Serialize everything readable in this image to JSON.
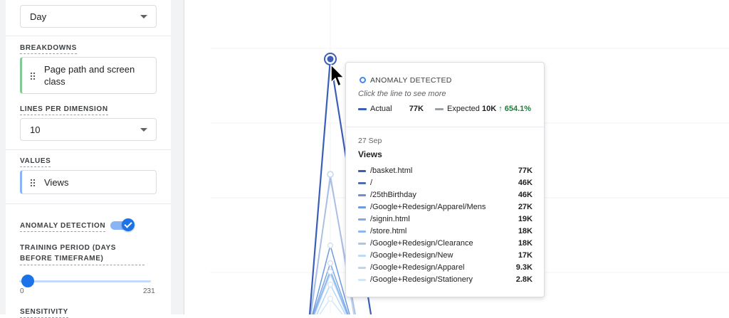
{
  "settings": {
    "granularity": {
      "value": "Day"
    },
    "breakdowns": {
      "label": "BREAKDOWNS",
      "item": "Page path and screen class"
    },
    "lines_per_dimension": {
      "label": "LINES PER DIMENSION",
      "value": "10"
    },
    "values": {
      "label": "VALUES",
      "item": "Views"
    },
    "anomaly_detection": {
      "label": "ANOMALY DETECTION",
      "enabled": true
    },
    "training_period": {
      "label": "TRAINING PERIOD (DAYS BEFORE TIMEFRAME)",
      "min": "0",
      "max": "231",
      "value": 0
    },
    "sensitivity": {
      "label": "SENSITIVITY"
    }
  },
  "tooltip": {
    "header": "ANOMALY DETECTED",
    "hint": "Click the line to see more",
    "actual_label": "Actual",
    "actual_value": "77K",
    "expected_label": "Expected",
    "expected_value": "10K",
    "change": "↑ 654.1%",
    "date": "27 Sep",
    "metric": "Views",
    "rows": [
      {
        "name": "/basket.html",
        "value": "77K",
        "color": "#3b5fb8"
      },
      {
        "name": "/",
        "value": "46K",
        "color": "#4f6dae"
      },
      {
        "name": "/25thBirthday",
        "value": "46K",
        "color": "#6b8fd0"
      },
      {
        "name": "/Google+Redesign/Apparel/Mens",
        "value": "27K",
        "color": "#6e9be0"
      },
      {
        "name": "/signin.html",
        "value": "19K",
        "color": "#7fa9e8"
      },
      {
        "name": "/store.html",
        "value": "18K",
        "color": "#8db8ee"
      },
      {
        "name": "/Google+Redesign/Clearance",
        "value": "18K",
        "color": "#a3c9f1"
      },
      {
        "name": "/Google+Redesign/New",
        "value": "17K",
        "color": "#bdd9f5"
      },
      {
        "name": "/Google+Redesign/Apparel",
        "value": "9.3K",
        "color": "#b5d8f7"
      },
      {
        "name": "/Google+Redesign/Stationery",
        "value": "2.8K",
        "color": "#d4e7f8"
      }
    ]
  },
  "colors": {
    "accent": "#1a73e8",
    "actual_line": "#3b5fb8",
    "expected_line": "#9aa0a6",
    "positive_change": "#188038"
  },
  "icons": {
    "anomaly": "anomaly-icon",
    "drag": "drag-handle-icon",
    "caret": "chevron-down-icon"
  }
}
